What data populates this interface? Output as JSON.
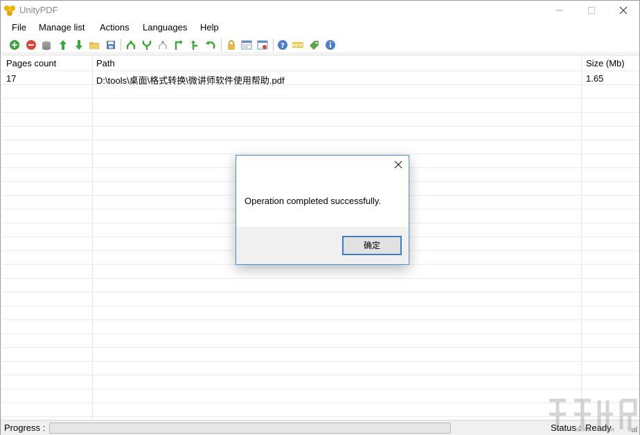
{
  "window": {
    "title": "UnityPDF"
  },
  "menu": {
    "items": [
      "File",
      "Manage list",
      "Actions",
      "Languages",
      "Help"
    ]
  },
  "toolbar": {
    "icons": [
      "add-icon",
      "remove-icon",
      "clear-icon",
      "move-up-icon",
      "move-down-icon",
      "open-folder-icon",
      "save-list-icon",
      "merge-icon",
      "split-icon",
      "extract-icon",
      "rotate-right-icon",
      "rotate-left-icon",
      "undo-icon",
      "lock-icon",
      "document-info-icon",
      "properties-icon",
      "help-icon",
      "new-icon",
      "tag-icon",
      "info-icon"
    ]
  },
  "table": {
    "headers": [
      "Pages count",
      "Path",
      "Size (Mb)"
    ],
    "rows": [
      {
        "pages": "17",
        "path": "D:\\tools\\桌面\\格式转换\\微讲师软件使用帮助.pdf",
        "size": "1.65"
      }
    ]
  },
  "statusbar": {
    "progress_label": "Progress :",
    "progress": 0,
    "status_label": "Status :",
    "status_value": "Ready"
  },
  "dialog": {
    "message": "Operation completed successfully.",
    "ok_label": "确定"
  },
  "colors": {
    "accent": "#3c7ec6",
    "dialog_border": "#4a8fd1",
    "progress_fill": "#06b025"
  }
}
